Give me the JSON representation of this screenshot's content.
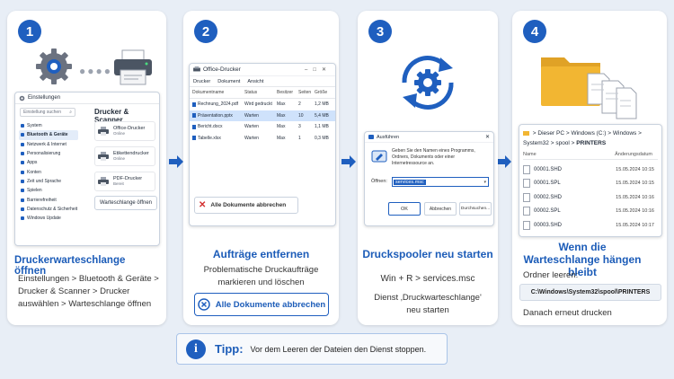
{
  "steps": [
    {
      "num": "1",
      "title": "Druckerwarteschlange öffnen",
      "desc": "Einstellungen > Bluetooth & Geräte > Drucker & Scanner > Drucker auswählen > Warteschlange öffnen"
    },
    {
      "num": "2",
      "title": "Aufträge entfernen",
      "desc": "Problematische Druckaufträge markieren und löschen",
      "cancel_all": "Alle Dokumente abbrechen"
    },
    {
      "num": "3",
      "title": "Druckspooler neu starten",
      "shortcut": "Win + R > services.msc",
      "desc": "Dienst ‚Druckwarteschlange' neu starten"
    },
    {
      "num": "4",
      "title": "Wenn die Warteschlange hängen bleibt",
      "clear_label": "Ordner leeren:",
      "path": "C:\\Windows\\System32\\spool\\PRINTERS",
      "after": "Danach erneut drucken"
    }
  ],
  "settings": {
    "title": "Einstellungen",
    "search_placeholder": "Einstellung suchen",
    "nav": [
      "System",
      "Bluetooth & Geräte",
      "Netzwerk & Internet",
      "Personalisierung",
      "Apps",
      "Konten",
      "Zeit und Sprache",
      "Spielen",
      "Barrierefreiheit",
      "Datenschutz & Sicherheit",
      "Windows Update"
    ],
    "active_index": 1,
    "section_title": "Drucker & Scanner",
    "printers": [
      {
        "name": "Office-Drucker",
        "status": "Online"
      },
      {
        "name": "Etikettendrucker",
        "status": "Online"
      },
      {
        "name": "PDF-Drucker",
        "status": "Bereit"
      }
    ],
    "open_queue": "Warteschlange öffnen"
  },
  "queue": {
    "title": "Office-Drucker",
    "menu": [
      "Drucker",
      "Dokument",
      "Ansicht"
    ],
    "columns": [
      "Dokumentname",
      "Status",
      "Besitzer",
      "Seiten",
      "Größe"
    ],
    "rows": [
      [
        "Rechnung_2024.pdf",
        "Wird gedruckt",
        "Max",
        "2",
        "1,2 MB"
      ],
      [
        "Präsentation.pptx",
        "Warten",
        "Max",
        "10",
        "5,4 MB"
      ],
      [
        "Bericht.docx",
        "Warten",
        "Max",
        "3",
        "1,1 MB"
      ],
      [
        "Tabelle.xlsx",
        "Warten",
        "Max",
        "1",
        "0,3 MB"
      ]
    ],
    "selected_row": 1,
    "cancel_all": "Alle Dokumente abbrechen"
  },
  "run": {
    "title": "Ausführen",
    "text": "Geben Sie den Namen eines Programms, Ordners, Dokuments oder einer Internetressource an.",
    "open_label": "Öffnen:",
    "value": "services.msc",
    "ok": "OK",
    "cancel": "Abbrechen",
    "browse": "Durchsuchen..."
  },
  "explorer": {
    "crumbs": [
      "Dieser PC",
      "Windows (C:)",
      "Windows",
      "System32",
      "spool",
      "PRINTERS"
    ],
    "col_name": "Name",
    "col_date": "Änderungsdatum",
    "files": [
      {
        "name": "00001.SHD",
        "date": "15.05.2024 10:15"
      },
      {
        "name": "00001.SPL",
        "date": "15.05.2024 10:15"
      },
      {
        "name": "00002.SHD",
        "date": "15.05.2024 10:16"
      },
      {
        "name": "00002.SPL",
        "date": "15.05.2024 10:16"
      },
      {
        "name": "00003.SHD",
        "date": "15.05.2024 10:17"
      }
    ]
  },
  "tip": {
    "label": "Tipp:",
    "text": "Vor dem Leeren der Dateien den Dienst stoppen."
  },
  "colors": {
    "accent": "#1f5fbf",
    "danger": "#d32f2f",
    "folder": "#f2b632",
    "bg": "#e8eef6"
  }
}
